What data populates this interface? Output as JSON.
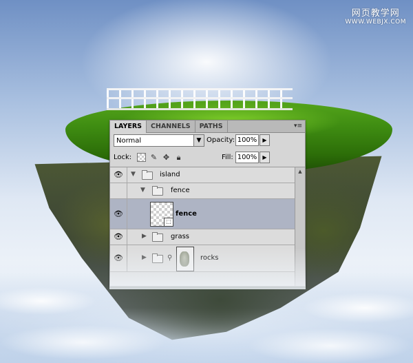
{
  "watermark": {
    "line1": "网页教学网",
    "line2": "WWW.WEBJX.COM"
  },
  "panel": {
    "tabs": [
      "LAYERS",
      "CHANNELS",
      "PATHS"
    ],
    "menu_icon": "panel-menu-icon",
    "blend_mode": "Normal",
    "opacity_label": "Opacity:",
    "opacity_value": "100%",
    "lock_label": "Lock:",
    "lock_icons": [
      "lock-transparent-pixels-icon",
      "lock-image-pixels-icon",
      "lock-position-icon",
      "lock-all-icon"
    ],
    "fill_label": "Fill:",
    "fill_value": "100%"
  },
  "layers": [
    {
      "name": "island",
      "type": "group",
      "expanded": true,
      "visible": true
    },
    {
      "name": "fence",
      "type": "group",
      "expanded": true,
      "visible": false
    },
    {
      "name": "fence",
      "type": "layer",
      "selected": true,
      "visible": true
    },
    {
      "name": "grass",
      "type": "group",
      "expanded": false,
      "visible": true
    },
    {
      "name": "rocks",
      "type": "group-with-mask",
      "expanded": false,
      "visible": true
    }
  ]
}
